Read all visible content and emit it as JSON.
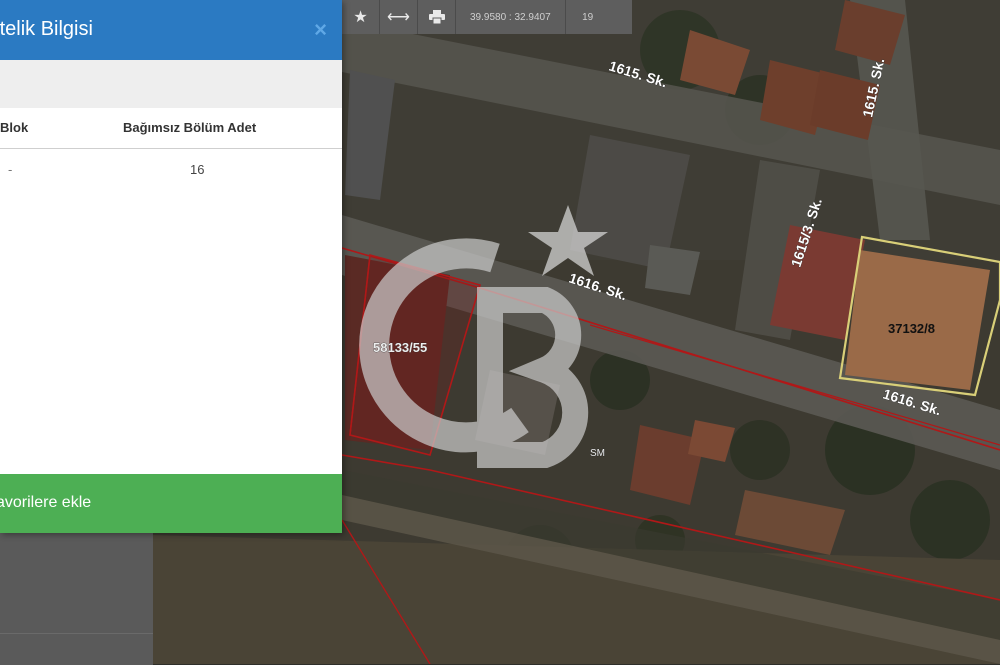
{
  "panel": {
    "title": "nitelik Bilgisi",
    "close_icon": "×",
    "columns": {
      "blok": "Blok",
      "adet": "Bağımsız Bölüm Adet"
    },
    "rows": [
      {
        "blok": "-",
        "adet": "16"
      }
    ],
    "favorite_label": "avorilere ekle",
    "colors": {
      "header": "#2b7ac2",
      "favorite": "#4daf54"
    }
  },
  "toolbar": {
    "icons": [
      "star-icon",
      "measure-distance-icon",
      "print-icon"
    ],
    "coordinates": "39.9580 : 32.9407",
    "zoom_level": "19"
  },
  "map": {
    "roads": [
      "1615. Sk.",
      "1615. Sk.",
      "1615/3. Sk.",
      "1616. Sk.",
      "1616. Sk."
    ],
    "parcels": [
      "58133/55",
      "37132/8"
    ],
    "watermark_extra": "SM",
    "colors": {
      "parcel_border": "#b01818",
      "highlight_parcel": "#d9cf78"
    }
  }
}
